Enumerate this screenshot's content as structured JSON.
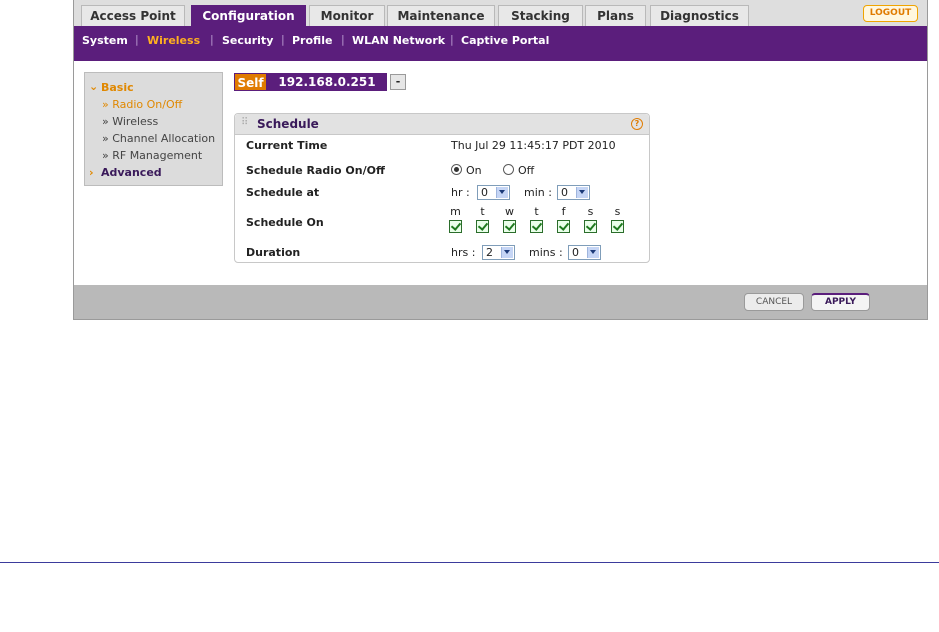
{
  "top_tabs": [
    {
      "label": "Access Point",
      "active": false
    },
    {
      "label": "Configuration",
      "active": true
    },
    {
      "label": "Monitor",
      "active": false
    },
    {
      "label": "Maintenance",
      "active": false
    },
    {
      "label": "Stacking",
      "active": false
    },
    {
      "label": "Plans",
      "active": false
    },
    {
      "label": "Diagnostics",
      "active": false
    }
  ],
  "logout_label": "LOGOUT",
  "sub_nav": [
    {
      "label": "System",
      "active": false
    },
    {
      "label": "Wireless",
      "active": true
    },
    {
      "label": "Security",
      "active": false
    },
    {
      "label": "Profile",
      "active": false
    },
    {
      "label": "WLAN Network",
      "active": false
    },
    {
      "label": "Captive Portal",
      "active": false
    }
  ],
  "left_menu": {
    "basic_label": "Basic",
    "items": [
      {
        "label": "» Radio On/Off",
        "active": true
      },
      {
        "label": "» Wireless",
        "active": false
      },
      {
        "label": "» Channel Allocation",
        "active": false
      },
      {
        "label": "» RF Management",
        "active": false
      }
    ],
    "advanced_label": "Advanced"
  },
  "ap_selector": {
    "self_label": "Self",
    "ip": "192.168.0.251",
    "dash": "-"
  },
  "schedule": {
    "title": "Schedule",
    "help_icon": "?",
    "current_time_label": "Current Time",
    "current_time_value": "Thu Jul 29 11:45:17 PDT 2010",
    "radio_label": "Schedule Radio On/Off",
    "radio_on": "On",
    "radio_off": "Off",
    "radio_selected": "On",
    "schedule_at_label": "Schedule at",
    "hr_label": "hr :",
    "hr_value": "0",
    "min_label": "min :",
    "min_value": "0",
    "schedule_on_label": "Schedule On",
    "days": [
      "m",
      "t",
      "w",
      "t",
      "f",
      "s",
      "s"
    ],
    "days_checked": [
      true,
      true,
      true,
      true,
      true,
      true,
      true
    ],
    "duration_label": "Duration",
    "hrs_label": "hrs :",
    "hrs_value": "2",
    "mins_label": "mins :",
    "mins_value": "0"
  },
  "footer": {
    "cancel_label": "CANCEL",
    "apply_label": "APPLY"
  },
  "colors": {
    "brand_purple": "#5b1e7c",
    "accent_orange": "#e07b00"
  }
}
